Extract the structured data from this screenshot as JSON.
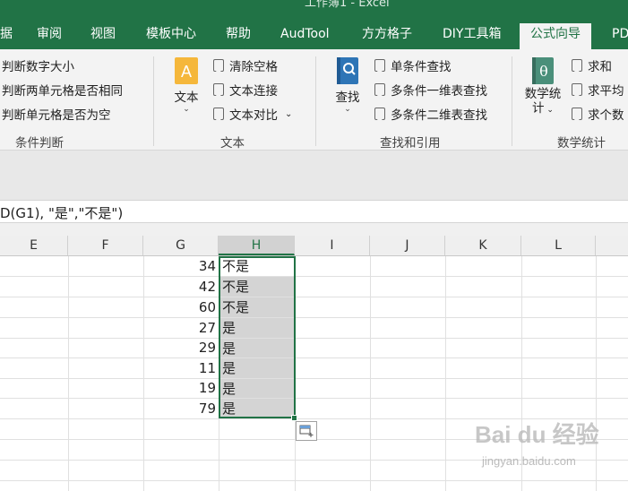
{
  "window": {
    "title": "工作簿1 - Excel"
  },
  "tabs": [
    {
      "label": "据"
    },
    {
      "label": "审阅"
    },
    {
      "label": "视图"
    },
    {
      "label": "模板中心"
    },
    {
      "label": "帮助"
    },
    {
      "label": "AudTool"
    },
    {
      "label": "方方格子"
    },
    {
      "label": "DIY工具箱"
    },
    {
      "label": "公式向导"
    },
    {
      "label": "PD"
    }
  ],
  "active_tab": "公式向导",
  "ribbon": {
    "condition": {
      "items": [
        "判断数字大小",
        "判断两单元格是否相同",
        "判断单元格是否为空"
      ],
      "label": "条件判断"
    },
    "text": {
      "big_button": "文本",
      "items": [
        "清除空格",
        "文本连接",
        "文本对比"
      ],
      "label": "文本"
    },
    "lookup": {
      "big_button": "查找",
      "items": [
        "单条件查找",
        "多条件一维表查找",
        "多条件二维表查找"
      ],
      "label": "查找和引用"
    },
    "math": {
      "big_button_line1": "数学统",
      "big_button_line2": "计",
      "items": [
        "求和",
        "求平均",
        "求个数"
      ],
      "label": "数学统计"
    },
    "icon_glyphs": {
      "text_icon": "A",
      "math_icon": "θ"
    }
  },
  "formula_bar": {
    "text": "D(G1), \"是\",\"不是\")"
  },
  "columns": [
    "E",
    "F",
    "G",
    "H",
    "I",
    "J",
    "K",
    "L"
  ],
  "selected_column": "H",
  "rows": [
    {
      "g": "34",
      "h": "不是"
    },
    {
      "g": "42",
      "h": "不是"
    },
    {
      "g": "60",
      "h": "不是"
    },
    {
      "g": "27",
      "h": "是"
    },
    {
      "g": "29",
      "h": "是"
    },
    {
      "g": "11",
      "h": "是"
    },
    {
      "g": "19",
      "h": "是"
    },
    {
      "g": "79",
      "h": "是"
    }
  ],
  "watermark": {
    "main": "Bai du 经验",
    "sub": "jingyan.baidu.com"
  },
  "colors": {
    "excel_green": "#217346",
    "ribbon_bg": "#f3f3f3",
    "selection_fill": "#d4d4d4"
  }
}
